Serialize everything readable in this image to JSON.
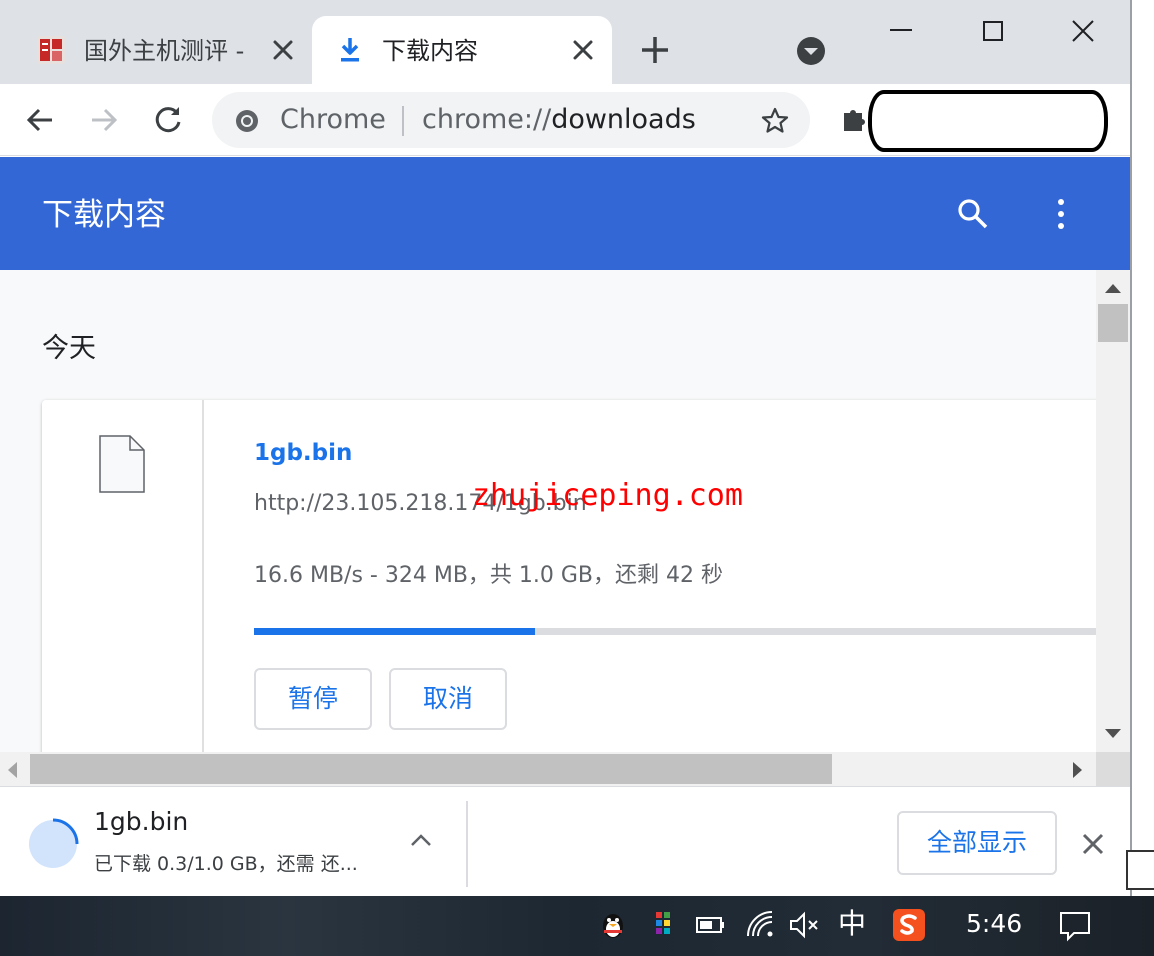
{
  "tabs": [
    {
      "title": "国外主机测评 - |",
      "active": false,
      "favicon": "site-logo-icon"
    },
    {
      "title": "下载内容",
      "active": true,
      "favicon": "download-icon"
    }
  ],
  "toolbar": {
    "omnibox_scheme_label": "Chrome",
    "url_prefix": "chrome://",
    "url_host": "downloads"
  },
  "page": {
    "title": "下载内容",
    "date_group": "今天"
  },
  "download_item": {
    "file_name": "1gb.bin",
    "url": "http://23.105.218.174/1gb.bin",
    "status": "16.6 MB/s - 324 MB，共 1.0 GB，还剩 42 秒",
    "progress": 0.324,
    "pause_label": "暂停",
    "cancel_label": "取消"
  },
  "watermark": "zhujiceping.com",
  "shelf": {
    "file_name": "1gb.bin",
    "status": "已下载 0.3/1.0 GB，还需 还...",
    "show_all_label": "全部显示"
  },
  "taskbar": {
    "ime": "中",
    "clock": "5:46"
  },
  "colors": {
    "header_blue": "#3367d6",
    "link_blue": "#1a73e8",
    "watermark_red": "#ff0000"
  }
}
